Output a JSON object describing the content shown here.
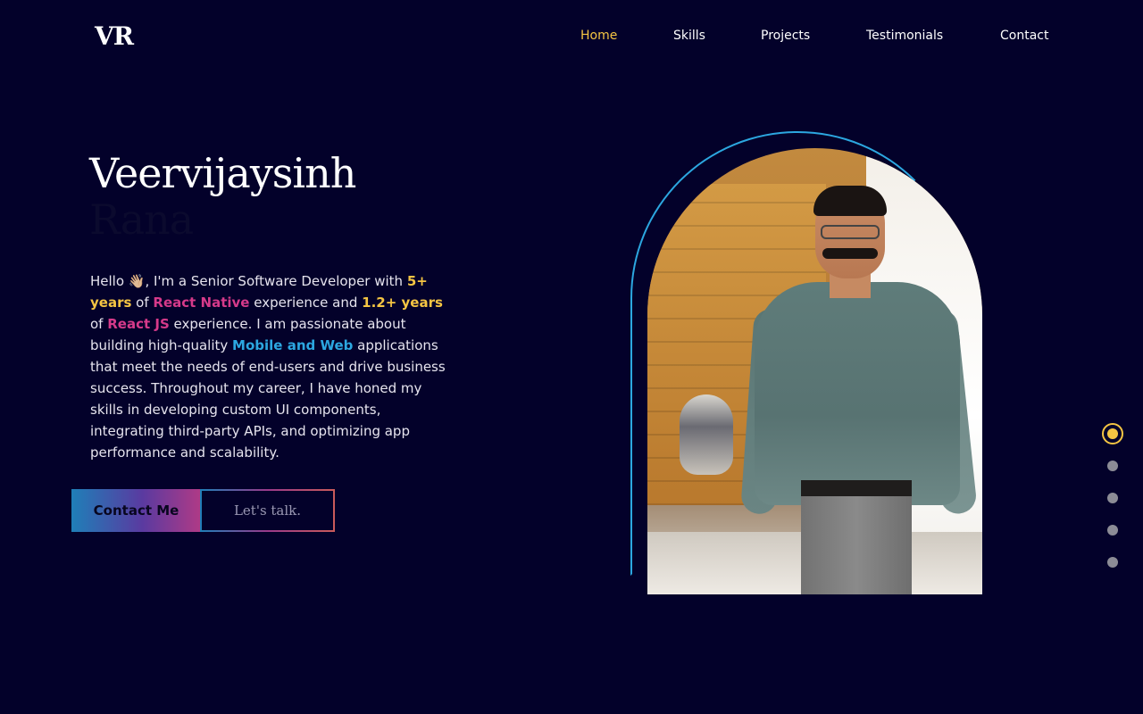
{
  "logo": {
    "text": "VR"
  },
  "nav": {
    "items": [
      {
        "label": "Home",
        "active": true
      },
      {
        "label": "Skills",
        "active": false
      },
      {
        "label": "Projects",
        "active": false
      },
      {
        "label": "Testimonials",
        "active": false
      },
      {
        "label": "Contact",
        "active": false
      }
    ]
  },
  "hero": {
    "name": "Veervijaysinh",
    "surname": "Rana",
    "bio": {
      "p1": "Hello 👋🏼, I'm a Senior Software Developer with ",
      "hl1": "5+ years",
      "p2": " of ",
      "hl2": "React Native",
      "p3": " experience and ",
      "hl3": "1.2+ years",
      "p4": " of ",
      "hl4": "React JS",
      "p5": " experience. I am passionate about building high-quality ",
      "hl5": "Mobile and Web",
      "p6": " applications that meet the needs of end-users and drive business success. Throughout my career, I have honed my skills in developing custom UI components, integrating third-party APIs, and optimizing app performance and scalability."
    },
    "buttons": {
      "primary": "Contact Me",
      "secondary": "Let's talk."
    }
  },
  "pagination": {
    "count": 5,
    "active_index": 0
  },
  "colors": {
    "background": "#03012a",
    "accent_yellow": "#f5c543",
    "accent_pink": "#d63a8a",
    "accent_blue": "#2ca7e0"
  }
}
